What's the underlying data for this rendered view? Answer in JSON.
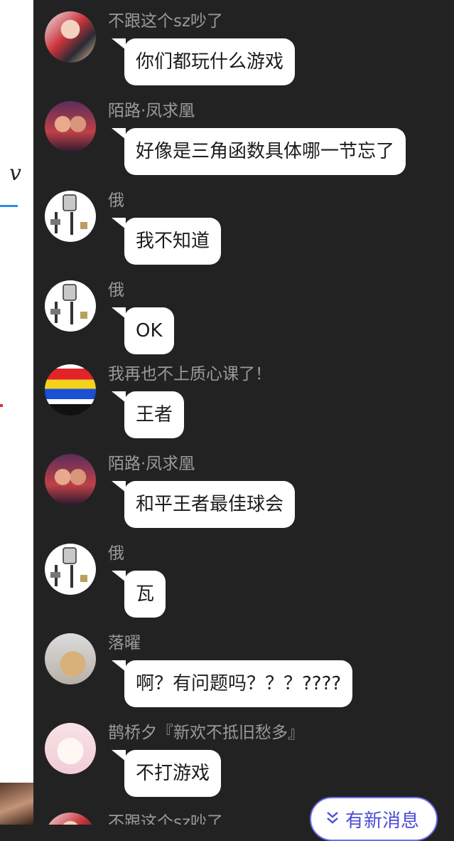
{
  "messages": [
    {
      "sender": "不跟这个sz吵了",
      "text": "你们都玩什么游戏",
      "avatar": "anime-avatar"
    },
    {
      "sender": "陌路·凤求凰",
      "text": "好像是三角函数具体哪一节忘了",
      "avatar": "couple-avatar"
    },
    {
      "sender": "俄",
      "text": "我不知道",
      "avatar": "robot-avatar"
    },
    {
      "sender": "俄",
      "text": "OK",
      "avatar": "robot-avatar"
    },
    {
      "sender": "我再也不上质心课了！",
      "text": "王者",
      "avatar": "flag-avatar"
    },
    {
      "sender": "陌路·凤求凰",
      "text": "和平王者最佳球会",
      "avatar": "couple-avatar"
    },
    {
      "sender": "俄",
      "text": "瓦",
      "avatar": "robot-avatar"
    },
    {
      "sender": "落曜",
      "text": "啊？有问题吗？？？????",
      "avatar": "hand-avatar"
    },
    {
      "sender": "鹊桥夕『新欢不抵旧愁多』",
      "text": "不打游戏",
      "avatar": "cat-avatar"
    },
    {
      "sender": "不跟这个sz吵了",
      "avatar": "anime-avatar"
    }
  ],
  "new_messages_button": {
    "label": "有新消息",
    "icon": "double-chevron-down-icon"
  },
  "left_strip": {
    "glyph": "v"
  }
}
